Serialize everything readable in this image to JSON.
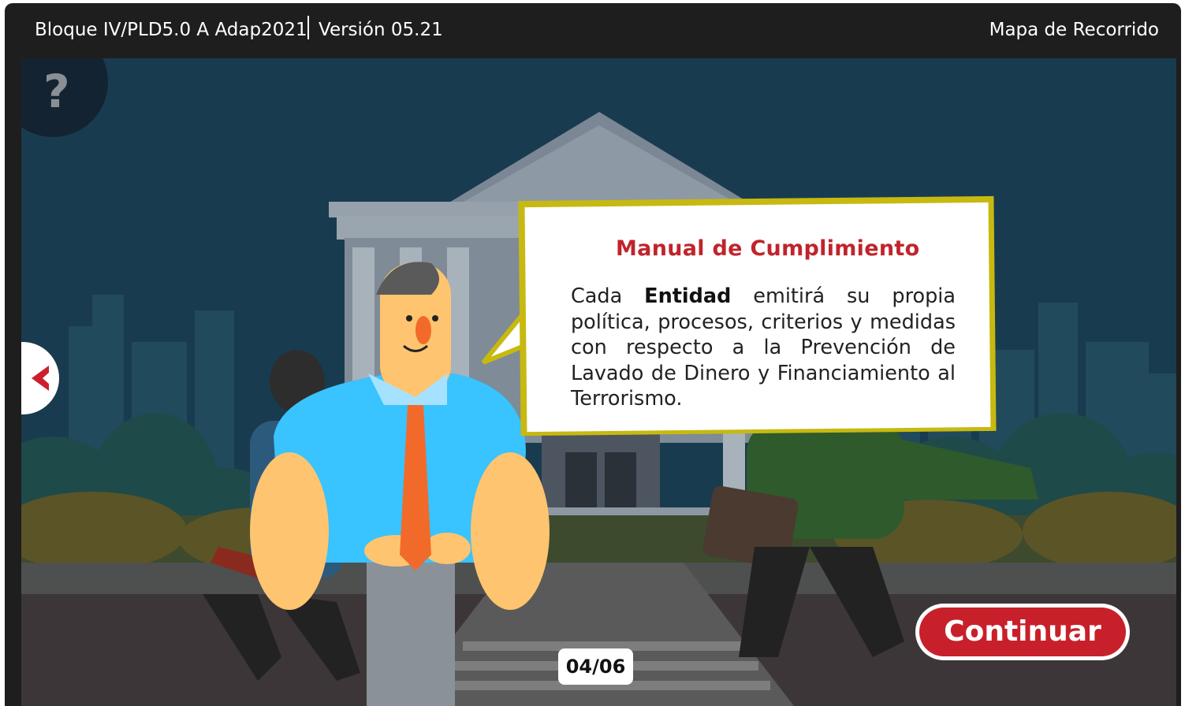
{
  "header": {
    "course_title": "Bloque IV/PLD5.0 A Adap2021",
    "version": "Versión 05.21",
    "map_link": "Mapa de Recorrido"
  },
  "stage": {
    "help_icon": "?",
    "back_icon": "chevron-left-icon",
    "bubble": {
      "title": "Manual de Cumplimiento",
      "text_before": "Cada ",
      "text_bold": "Entidad",
      "text_after": " emitirá su propia política, procesos, criterios y medidas con respecto a la Prevención de Lavado de Dinero y Financiamiento al Terrorismo."
    },
    "page_counter": "04/06",
    "continue_label": "Continuar"
  },
  "colors": {
    "accent_red": "#c8202b",
    "bubble_border": "#c7b910",
    "background": "#1c3d52"
  }
}
